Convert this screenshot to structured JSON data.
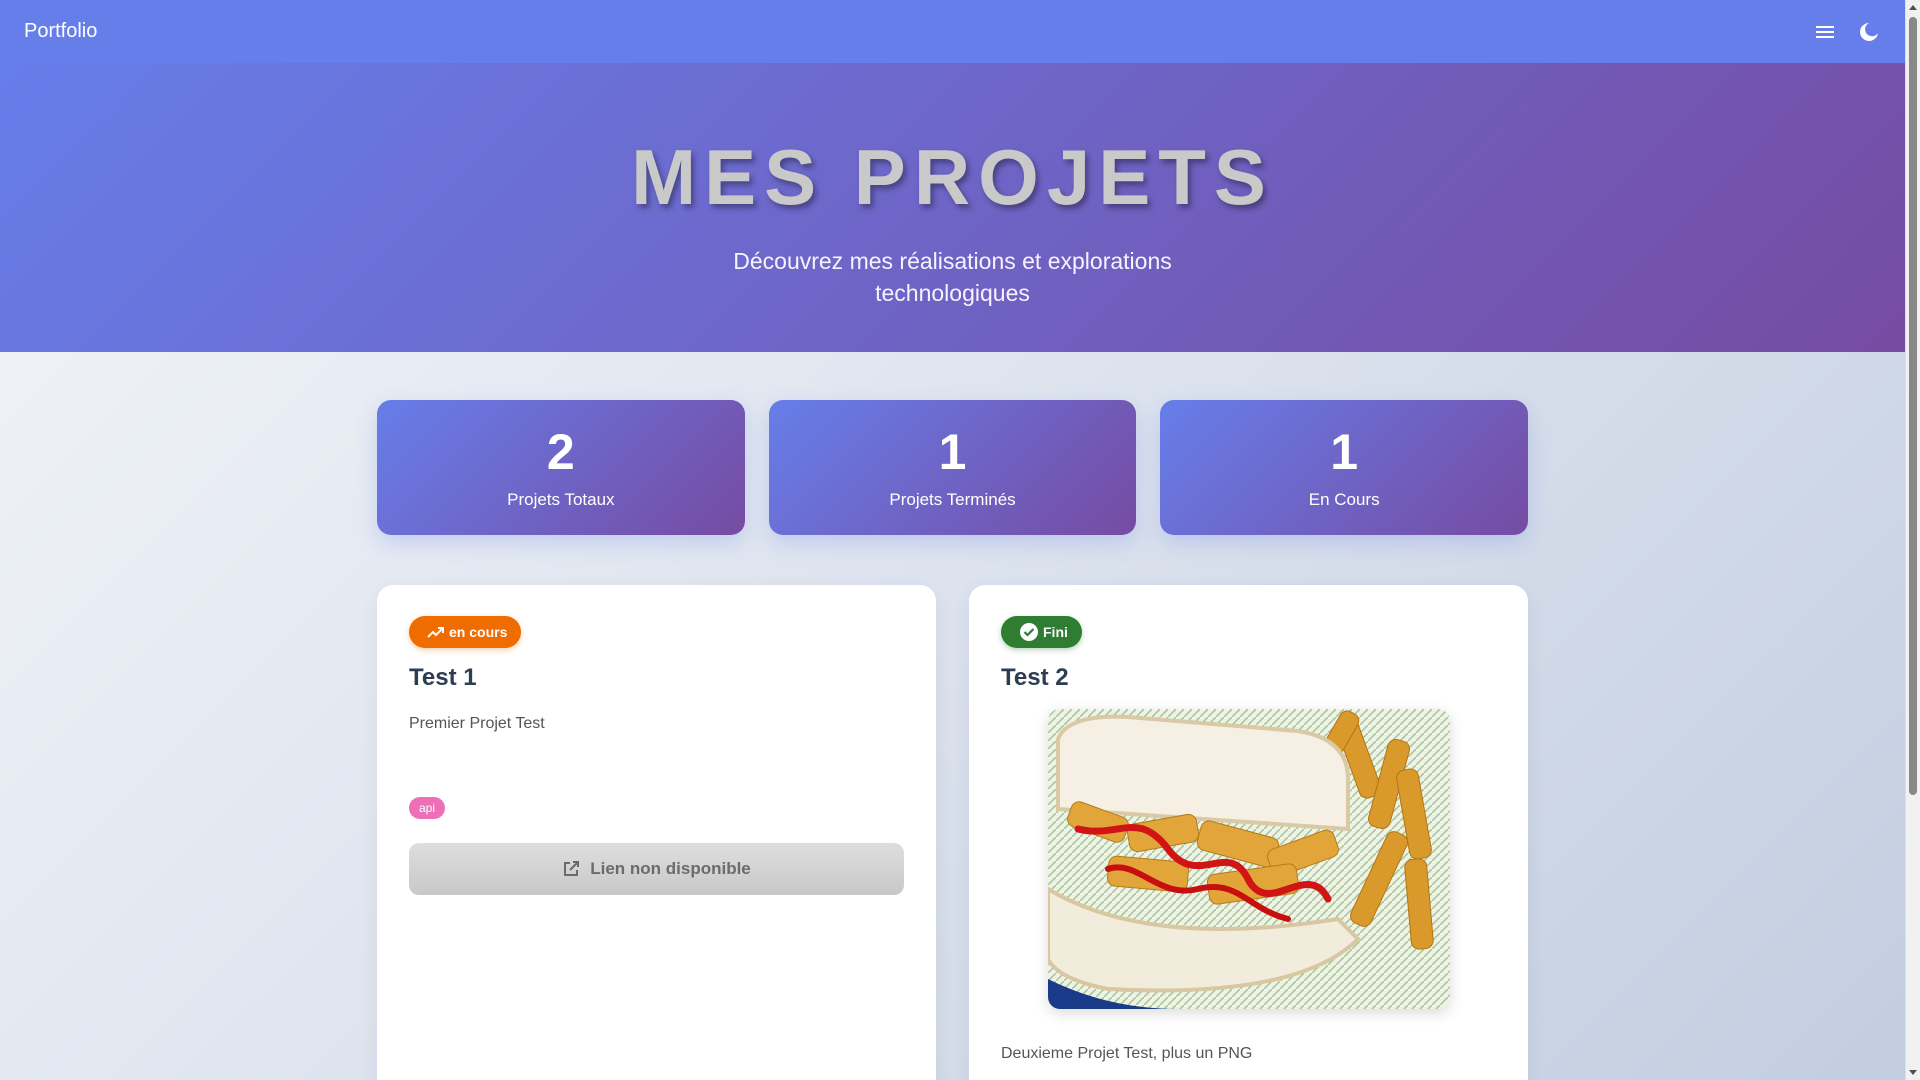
{
  "navbar": {
    "brand": "Portfolio",
    "menu_icon": "menu-icon",
    "theme_icon": "moon-icon"
  },
  "hero": {
    "title": "MES PROJETS",
    "subtitle": "Découvrez mes réalisations et explorations technologiques"
  },
  "stats": [
    {
      "value": "2",
      "label": "Projets Totaux"
    },
    {
      "value": "1",
      "label": "Projets Terminés"
    },
    {
      "value": "1",
      "label": "En Cours"
    }
  ],
  "projects": [
    {
      "status": "en cours",
      "status_icon": "trending-up-icon",
      "status_color": "#ef6c00",
      "title": "Test 1",
      "description": "Premier Projet Test",
      "tags": [
        "api"
      ],
      "link_label": "Lien non disponible",
      "link_icon": "external-link-icon"
    },
    {
      "status": "Fini",
      "status_icon": "check-circle-icon",
      "status_color": "#2e7d32",
      "title": "Test 2",
      "image": "chip-butty-sandwich-image",
      "description": "Deuxieme Projet Test, plus un PNG"
    }
  ],
  "colors": {
    "primary": "#667eea",
    "secondary": "#764ba2",
    "tag_pink": "#ec6fb7"
  }
}
